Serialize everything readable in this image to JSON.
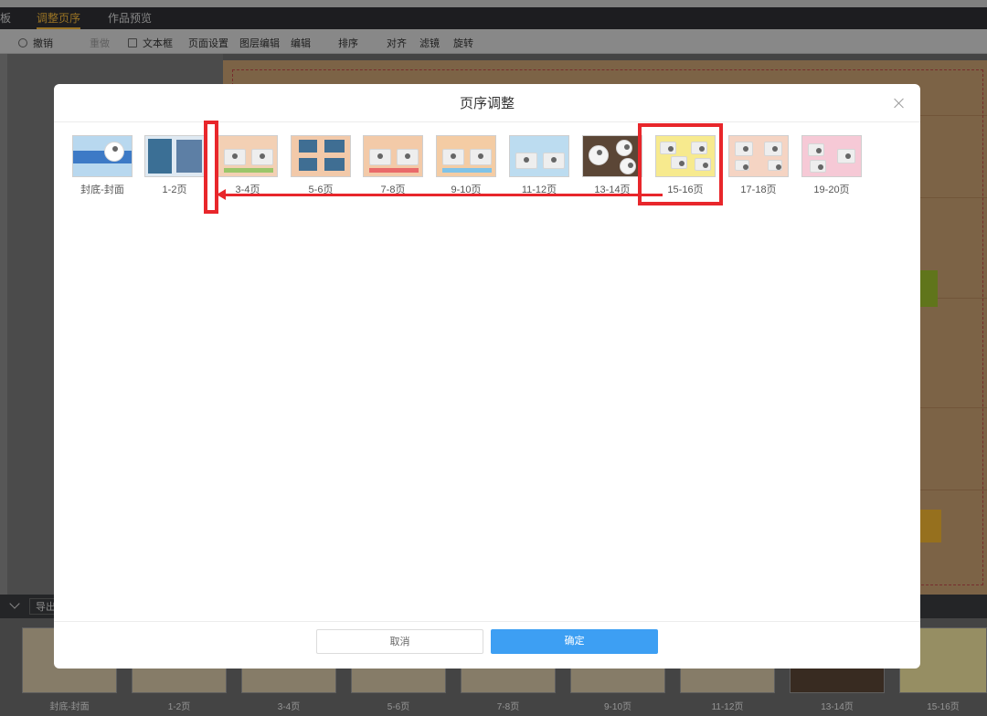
{
  "app": {
    "tabs": [
      {
        "label": "板"
      },
      {
        "label": "调整页序"
      },
      {
        "label": "作品预览"
      }
    ],
    "toolbar": {
      "undo": "撤销",
      "redo": "重做",
      "textbox": "文本框",
      "page_settings": "页面设置",
      "layer_edit": "图层编辑",
      "edit": "编辑",
      "sort": "排序",
      "align": "对齐",
      "filter": "滤镜",
      "rotate": "旋转"
    },
    "bottom": {
      "export": "导出"
    },
    "filmstrip": [
      "封底-封面",
      "1-2页",
      "3-4页",
      "5-6页",
      "7-8页",
      "9-10页",
      "11-12页",
      "13-14页",
      "15-16页"
    ]
  },
  "dialog": {
    "title": "页序调整",
    "pages": [
      {
        "label": "封底-封面",
        "bg": "#b8d8ef"
      },
      {
        "label": "1-2页",
        "bg": "#dfe9f2"
      },
      {
        "label": "3-4页",
        "bg": "#f3d0b4"
      },
      {
        "label": "5-6页",
        "bg": "#f2c9a9"
      },
      {
        "label": "7-8页",
        "bg": "#f3caa8"
      },
      {
        "label": "9-10页",
        "bg": "#f4cca4"
      },
      {
        "label": "11-12页",
        "bg": "#bcdcf0"
      },
      {
        "label": "13-14页",
        "bg": "#5b4636"
      },
      {
        "label": "15-16页",
        "bg": "#f7ea8e"
      },
      {
        "label": "17-18页",
        "bg": "#f5d4c3"
      },
      {
        "label": "19-20页",
        "bg": "#f6c9d6"
      }
    ],
    "cancel_label": "取消",
    "ok_label": "确定",
    "accent_color": "#3d9ff3",
    "highlight_color": "#e8262b"
  }
}
